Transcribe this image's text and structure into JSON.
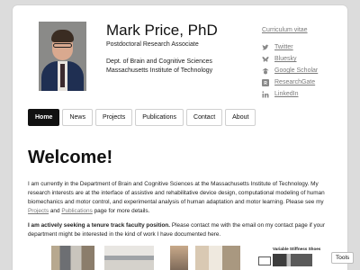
{
  "profile": {
    "name": "Mark Price, PhD",
    "position": "Postdoctoral Research Associate",
    "dept_line1": "Dept. of Brain and Cognitive Sciences",
    "dept_line2": "Massachusetts Institute of Technology"
  },
  "sidebar": {
    "cv_label": "Curriculum vitae",
    "links": [
      {
        "label": "Twitter",
        "icon": "twitter-icon"
      },
      {
        "label": "Bluesky",
        "icon": "bluesky-icon"
      },
      {
        "label": "Google Scholar",
        "icon": "google-scholar-icon"
      },
      {
        "label": "ResearchGate",
        "icon": "researchgate-icon"
      },
      {
        "label": "LinkedIn",
        "icon": "linkedin-icon"
      }
    ]
  },
  "nav": {
    "tabs": [
      {
        "label": "Home",
        "active": true
      },
      {
        "label": "News"
      },
      {
        "label": "Projects"
      },
      {
        "label": "Publications"
      },
      {
        "label": "Contact"
      },
      {
        "label": "About"
      }
    ]
  },
  "main": {
    "heading": "Welcome!",
    "p1_text": "I am currently in the Department of Brain and Cognitive Sciences at the Massachusetts Institute of Technology. My research interests are at the interface of assistive and rehabilitative device design, computational modeling of human biomechanics and motor control, and experimental analysis of human adaptation and motor learning. Please see my",
    "p1_link1": "Projects",
    "p1_and": "and",
    "p1_link2": "Publications",
    "p1_end": "page for more details.",
    "p2_bold": "I am actively seeking a tenure track faculty position.",
    "p2_rest": "Please contact me with the email on my contact page if your department might be interested in the kind of work I have documented here.",
    "figure_caption": "Variable Stiffness Shoes"
  },
  "tools_label": "Tools",
  "colors": {
    "link": "#7a7a7a",
    "active_tab": "#111111",
    "page_bg": "#dcdcdc"
  }
}
